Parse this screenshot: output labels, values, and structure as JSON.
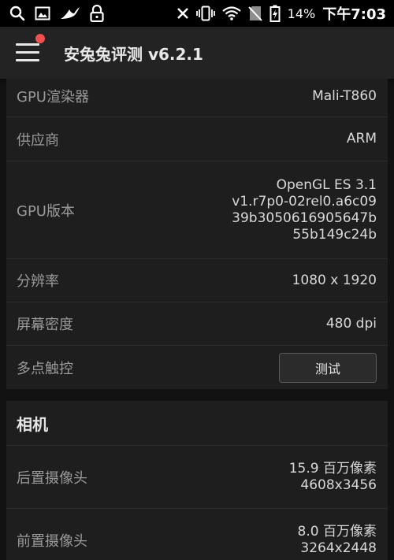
{
  "status_bar": {
    "battery_text": "14%",
    "time": "下午7:03"
  },
  "app_bar": {
    "title": "安兔兔评测 v6.2.1"
  },
  "gpu_card": {
    "rows": [
      {
        "label": "GPU渲染器",
        "value": "Mali-T860"
      },
      {
        "label": "供应商",
        "value": "ARM"
      },
      {
        "label": "GPU版本",
        "value_lines": [
          "OpenGL ES 3.1",
          "v1.r7p0-02rel0.a6c09",
          "39b3050616905647b",
          "55b149c24b"
        ]
      },
      {
        "label": "分辨率",
        "value": "1080 x 1920"
      },
      {
        "label": "屏幕密度",
        "value": "480 dpi"
      },
      {
        "label": "多点触控",
        "button_label": "测试"
      }
    ]
  },
  "camera_card": {
    "title": "相机",
    "rows": [
      {
        "label": "后置摄像头",
        "value_lines": [
          "15.9 百万像素",
          "4608x3456"
        ]
      },
      {
        "label": "前置摄像头",
        "value_lines": [
          "8.0 百万像素",
          "3264x2448"
        ]
      }
    ]
  }
}
